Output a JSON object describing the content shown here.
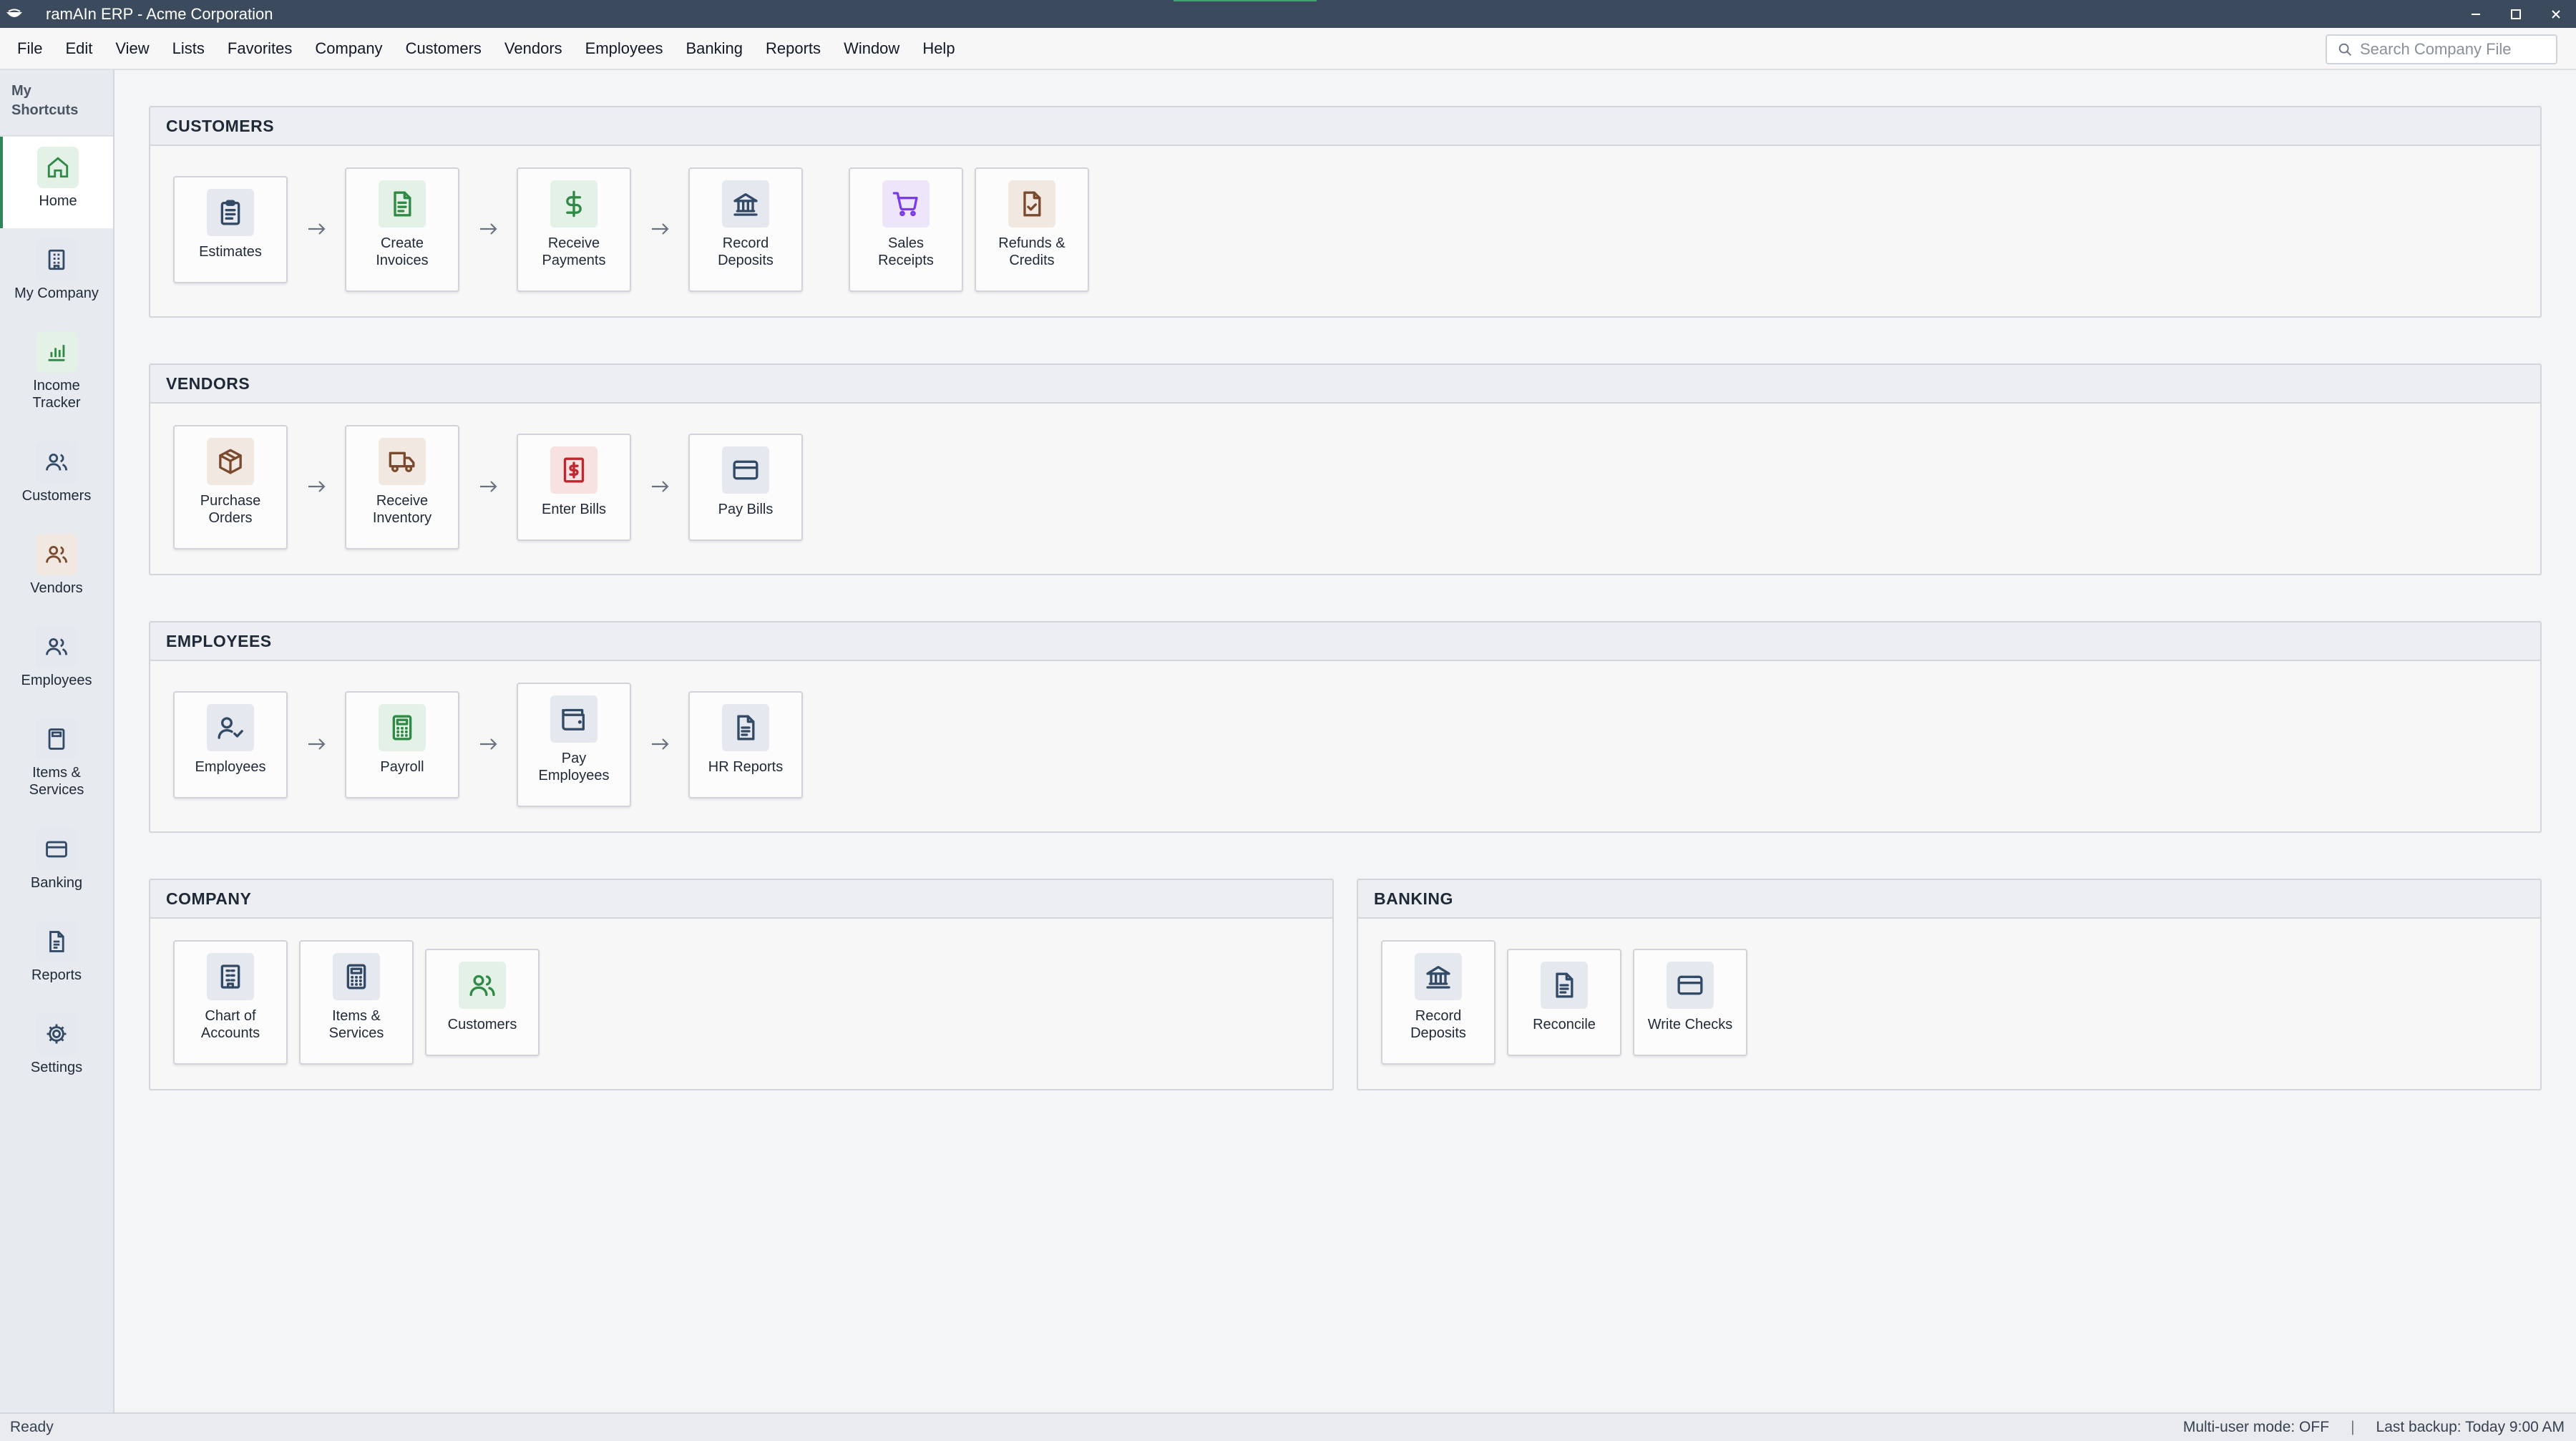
{
  "window": {
    "title": "ramAIn ERP - Acme Corporation"
  },
  "menu": [
    "File",
    "Edit",
    "View",
    "Lists",
    "Favorites",
    "Company",
    "Customers",
    "Vendors",
    "Employees",
    "Banking",
    "Reports",
    "Window",
    "Help"
  ],
  "search": {
    "placeholder": "Search Company File"
  },
  "sidebar": {
    "header": "My Shortcuts",
    "items": [
      {
        "label": "Home",
        "icon": "home-icon"
      },
      {
        "label": "My Company",
        "icon": "building-icon"
      },
      {
        "label": "Income Tracker",
        "icon": "bar-chart-icon"
      },
      {
        "label": "Customers",
        "icon": "users-icon"
      },
      {
        "label": "Vendors",
        "icon": "users-icon"
      },
      {
        "label": "Employees",
        "icon": "users-icon"
      },
      {
        "label": "Items & Services",
        "icon": "calculator-icon"
      },
      {
        "label": "Banking",
        "icon": "credit-card-icon"
      },
      {
        "label": "Reports",
        "icon": "document-icon"
      },
      {
        "label": "Settings",
        "icon": "gear-icon"
      }
    ]
  },
  "sections": {
    "customers": {
      "title": "CUSTOMERS",
      "tiles": [
        {
          "label": "Estimates",
          "icon": "clipboard-icon"
        },
        {
          "label": "Create Invoices",
          "icon": "invoice-icon"
        },
        {
          "label": "Receive Payments",
          "icon": "dollar-icon"
        },
        {
          "label": "Record Deposits",
          "icon": "bank-icon"
        },
        {
          "label": "Sales Receipts",
          "icon": "cart-icon"
        },
        {
          "label": "Refunds & Credits",
          "icon": "refund-document-icon"
        }
      ]
    },
    "vendors": {
      "title": "VENDORS",
      "tiles": [
        {
          "label": "Purchase Orders",
          "icon": "package-icon"
        },
        {
          "label": "Receive Inventory",
          "icon": "truck-icon"
        },
        {
          "label": "Enter Bills",
          "icon": "bill-icon"
        },
        {
          "label": "Pay Bills",
          "icon": "credit-card-icon"
        }
      ]
    },
    "employees": {
      "title": "EMPLOYEES",
      "tiles": [
        {
          "label": "Employees",
          "icon": "user-check-icon"
        },
        {
          "label": "Payroll",
          "icon": "calculator-icon"
        },
        {
          "label": "Pay Employees",
          "icon": "wallet-icon"
        },
        {
          "label": "HR Reports",
          "icon": "document-icon"
        }
      ]
    },
    "company": {
      "title": "COMPANY",
      "tiles": [
        {
          "label": "Chart of Accounts",
          "icon": "building-icon"
        },
        {
          "label": "Items & Services",
          "icon": "calculator-icon"
        },
        {
          "label": "Customers",
          "icon": "users-icon"
        }
      ]
    },
    "banking": {
      "title": "BANKING",
      "tiles": [
        {
          "label": "Record Deposits",
          "icon": "bank-icon"
        },
        {
          "label": "Reconcile",
          "icon": "document-icon"
        },
        {
          "label": "Write Checks",
          "icon": "credit-card-icon"
        }
      ]
    }
  },
  "status": {
    "left": "Ready",
    "multiuser": "Multi-user mode: OFF",
    "separator": "|",
    "backup": "Last backup: Today 9:00 AM"
  }
}
